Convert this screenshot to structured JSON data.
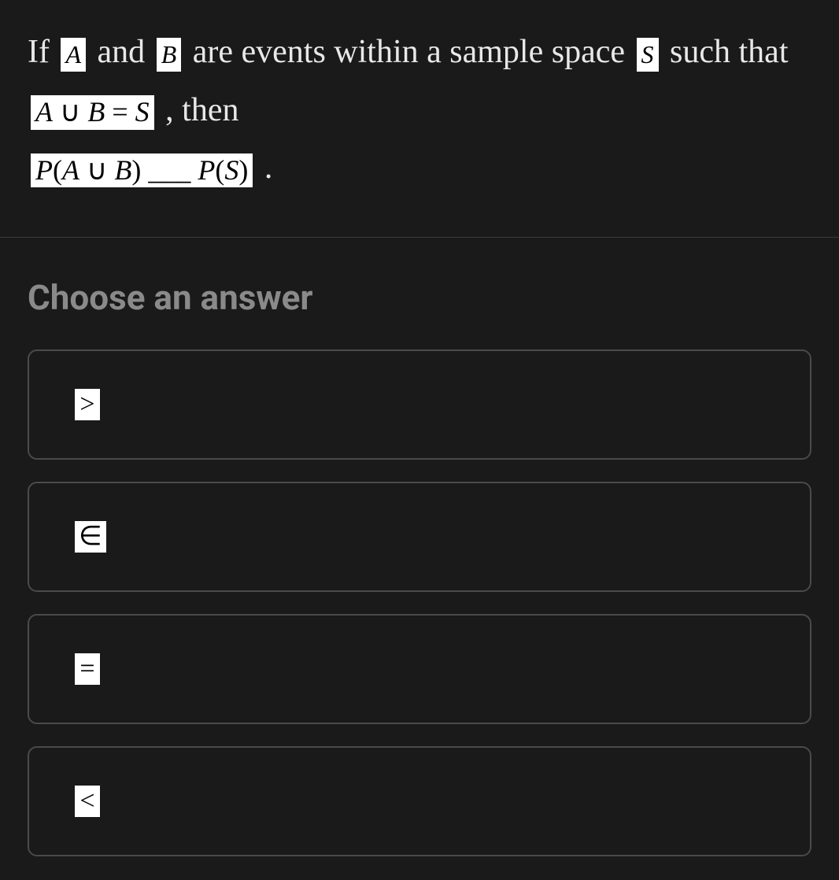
{
  "question": {
    "text_parts": {
      "p1": "If ",
      "p2": " and ",
      "p3": " are events within a sample space ",
      "p4": " such that ",
      "p5": " , then ",
      "p6": " ."
    },
    "math": {
      "A": "A",
      "B": "B",
      "S": "S",
      "union_eq": "A ∪ B = S",
      "prob_blank": "P(A ∪ B) ___ P(S)"
    }
  },
  "answer_heading": "Choose an answer",
  "options": [
    {
      "symbol": ">"
    },
    {
      "symbol": "∈"
    },
    {
      "symbol": "="
    },
    {
      "symbol": "<"
    }
  ]
}
